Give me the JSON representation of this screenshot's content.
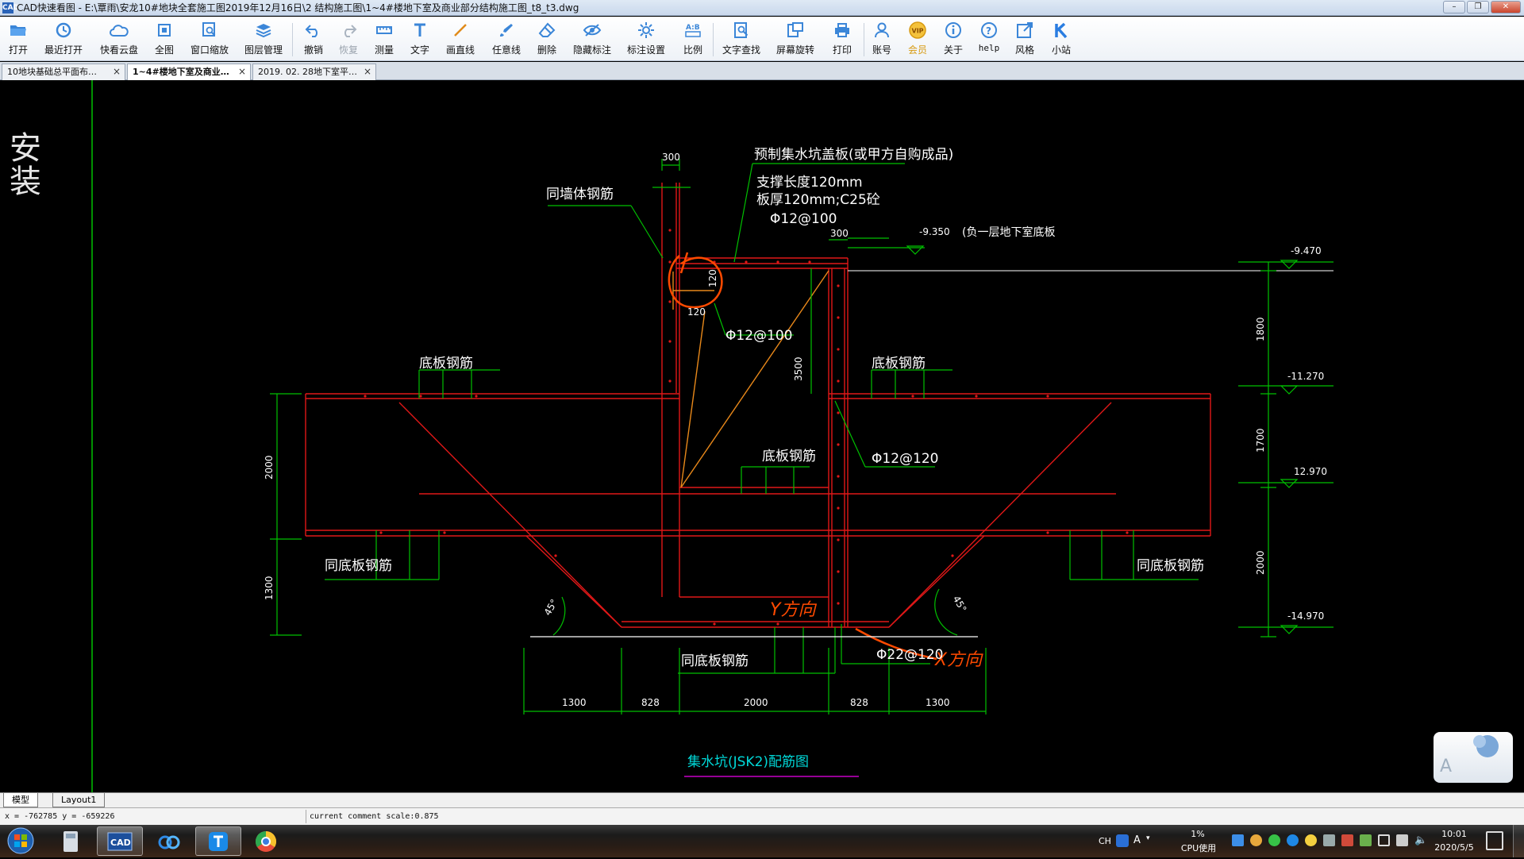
{
  "window": {
    "app_icon": "CAD",
    "title": "CAD快速看图 - E:\\覃雨\\安龙10#地块全套施工图2019年12月16日\\2   结构施工图\\1~4#楼地下室及商业部分结构施工图_t8_t3.dwg",
    "controls": [
      "minimize-icon",
      "restore-icon",
      "close-icon"
    ]
  },
  "toolbar": {
    "open": "打开",
    "recent": "最近打开",
    "cloud": "快看云盘",
    "full_view": "全图",
    "window_zoom": "窗口缩放",
    "layers": "图层管理",
    "undo": "撤销",
    "redo": "恢复",
    "measure": "测量",
    "text": "文字",
    "line": "画直线",
    "freehand": "任意线",
    "erase": "删除",
    "hide_marks": "隐藏标注",
    "mark_settings": "标注设置",
    "scale": "比例",
    "find_text": "文字查找",
    "rotate": "屏幕旋转",
    "print": "打印",
    "account": "账号",
    "vip": "会员",
    "about": "关于",
    "help": "help",
    "style": "风格",
    "site": "小站"
  },
  "tabs": [
    {
      "label": "10地块基础总平面布…",
      "close": "×"
    },
    {
      "label": "1~4#楼地下室及商业…",
      "close": "×"
    },
    {
      "label": "2019. 02. 28地下室平…",
      "close": "×"
    }
  ],
  "drawing": {
    "title": "集水坑(JSK2)配筋图",
    "side_text": "安装",
    "notes": {
      "cover": "预制集水坑盖板(或甲方自购成品)",
      "support": "支撑长度120mm",
      "thickness": "板厚120mm;C25砼",
      "cover_rebar": "Φ12@100",
      "wall_rebar": "同墙体钢筋",
      "slab_note": "(负一层地下室底板",
      "corner_rebar": "Φ12@100",
      "floor_rebar_l": "底板钢筋",
      "floor_rebar_r": "底板钢筋",
      "floor_rebar_c": "底板钢筋",
      "pit_wall_rebar": "Φ12@120",
      "same_floor_l": "同底板钢筋",
      "same_floor_r": "同底板钢筋",
      "same_floor_c": "同底板钢筋",
      "bottom_rebar": "Φ22@120",
      "annot_dir1": "Y方向",
      "annot_dir2": "X方向"
    },
    "dims": {
      "d300a": "300",
      "d300b": "300",
      "d120a": "120",
      "d120b": "120",
      "d3500": "3500",
      "d2000l": "2000",
      "d1300l": "1300",
      "d1800": "1800",
      "d1700": "1700",
      "d2000r": "2000",
      "bottom": [
        "1300",
        "828",
        "2000",
        "828",
        "1300"
      ],
      "angle_l": "45°",
      "angle_r": "45°"
    },
    "elevations": {
      "e1": "-9.350",
      "e2": "-9.470",
      "e3": "-11.270",
      "e4": "12.970",
      "e5": "-14.970"
    }
  },
  "layout_tabs": {
    "model": "模型",
    "layout1": "Layout1"
  },
  "status": {
    "coords": "x = -762785 y = -659226",
    "scale": "current comment scale:0.875"
  },
  "taskbar": {
    "ime": "CH",
    "cpu_value": "1%",
    "cpu_label": "CPU使用",
    "time": "10:01",
    "date": "2020/5/5"
  }
}
